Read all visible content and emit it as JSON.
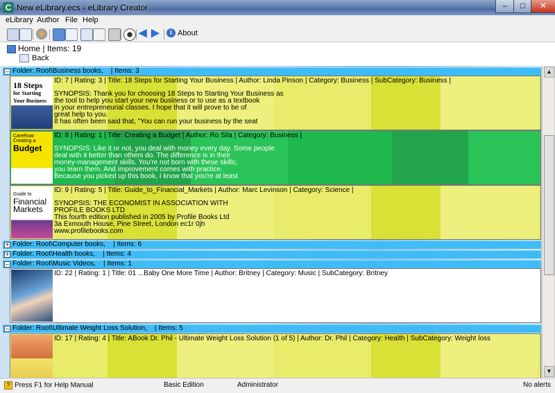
{
  "window": {
    "title": "New eLibrary.ecs - eLibrary Creator",
    "app_icon": "C"
  },
  "menu": [
    "eLibrary",
    "Author",
    "File",
    "Help"
  ],
  "toolbar": {
    "about_label": "About"
  },
  "nav": {
    "home": "Home",
    "items_label": "Items: 19",
    "back_label": "Back"
  },
  "folders": [
    {
      "label": "Folder: Root\\Business books,    | Items: 3",
      "expanded": true
    },
    {
      "label": "Folder: Root\\Computer books,    | Items: 6",
      "expanded": false
    },
    {
      "label": "Folder: Root\\Health books,    | Items: 4",
      "expanded": false
    },
    {
      "label": "Folder: Root\\Music Videos,    | Items: 1",
      "expanded": true
    },
    {
      "label": "Folder: Root\\Ultimate Weight Loss Solution,    | Items: 5",
      "expanded": true
    }
  ],
  "items": [
    {
      "info": "ID: 7 | Rating: 3 | Title: 18 Steps for Starting Your Business | Author: Linda Pinson | Category: Business | SubCategory: Business |",
      "synopsis": [
        "SYNOPSIS: Thank you for choosing 18 Steps to Starting Your Business as",
        "the tool to help you start your new business or to use as a textbook",
        "in your entrepreneurial classes. I hope that it will prove to be of",
        "great help to you.",
        "It has often been said that, \"You can run your business by the seat"
      ],
      "cover_text": [
        "18 Steps",
        "for Starting",
        "Your Business"
      ]
    },
    {
      "info": "ID: 8 | Rating: 1 | Title: Creating a Budget | Author: Ro Sila | Category: Business |",
      "synopsis": [
        "SYNOPSIS: Like it or not, you deal with money every day. Some people",
        "deal with it better than others do. The difference is in their",
        "money-management skills. You're not born with these skills;",
        "you learn them. And improvement comes with practice.",
        "Because you picked up this book, I know that you're at least"
      ],
      "cover_text": [
        "CareRoar",
        "Creating a",
        "Budget"
      ]
    },
    {
      "info": "ID: 9 | Rating: 5 | Title: Guide_to_Financial_Markets | Author: Marc Levinson | Category: Science |",
      "synopsis": [
        "SYNOPSIS: THE ECONOMIST IN ASSOCIATION WITH",
        "PROFILE BOOKS LTD",
        "This fourth edition published in 2005 by Profile Books Ltd",
        "3a Exmouth House, Pine Street, London ec1r 0jh",
        "www.profilebooks.com"
      ],
      "cover_text": [
        "Guide to",
        "Financial",
        "Markets"
      ]
    },
    {
      "info": "ID: 22 | Rating: 1 | Title: 01 ...Baby One More Time | Author: Britney | Category: Music | SubCategory: Britney",
      "synopsis": [],
      "cover_text": []
    },
    {
      "info": "ID: 17 | Rating: 4 | Title: ABook Dr. Phil - Ultimate Weight Loss Solution (1 of 5) | Author: Dr. Phil | Category: Health | SubCategory: Weight loss",
      "synopsis": [],
      "cover_text": []
    }
  ],
  "status": {
    "help": "Press F1 for Help Manual",
    "edition": "Basic Edition",
    "user": "Administrator",
    "alerts": "No alerts"
  }
}
